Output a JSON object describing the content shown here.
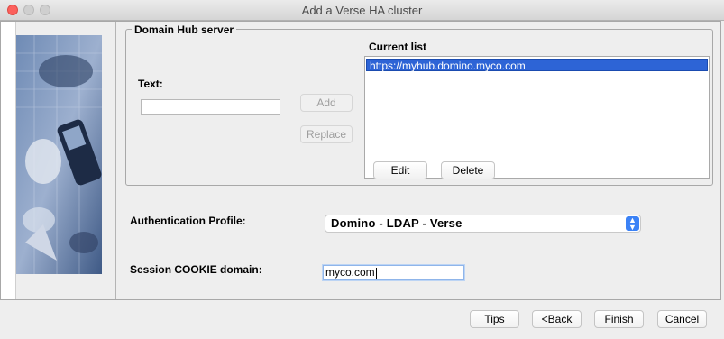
{
  "window": {
    "title": "Add a Verse HA cluster"
  },
  "domain_hub": {
    "group_title": "Domain Hub server",
    "text_label": "Text:",
    "text_value": "",
    "add_label": "Add",
    "replace_label": "Replace",
    "current_list_label": "Current list",
    "items": [
      "https://myhub.domino.myco.com"
    ],
    "edit_label": "Edit",
    "delete_label": "Delete"
  },
  "auth_profile": {
    "label": "Authentication Profile:",
    "selected": "Domino - LDAP - Verse"
  },
  "cookie_domain": {
    "label": "Session COOKIE domain:",
    "value": "myco.com"
  },
  "footer": {
    "tips_label": "Tips",
    "back_label": "<Back",
    "finish_label": "Finish",
    "cancel_label": "Cancel"
  },
  "colors": {
    "selection": "#2d64d6",
    "close_button": "#fc605c",
    "select_arrow": "#3b82f6"
  }
}
